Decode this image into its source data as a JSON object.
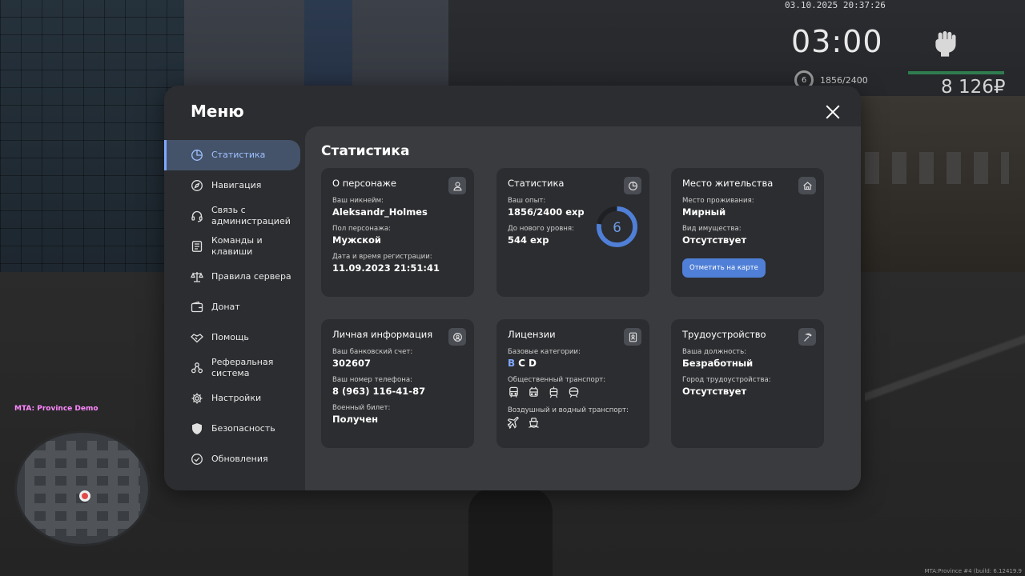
{
  "hud": {
    "datetime": "03.10.2025 20:37:26",
    "clock": "03:00",
    "level": "6",
    "exp": "1856/2400",
    "money": "8 126₽",
    "server": "MTA: Province Demo",
    "build": "MTA:Province #4 (build: 6.12419.9"
  },
  "menu": {
    "title": "Меню",
    "nav": [
      {
        "label": "Статистика",
        "icon": "pie-chart-icon"
      },
      {
        "label": "Навигация",
        "icon": "compass-icon"
      },
      {
        "label": "Связь с администрацией",
        "icon": "headset-icon"
      },
      {
        "label": "Команды и клавиши",
        "icon": "keyboard-icon"
      },
      {
        "label": "Правила сервера",
        "icon": "scales-icon"
      },
      {
        "label": "Донат",
        "icon": "wallet-icon"
      },
      {
        "label": "Помощь",
        "icon": "handshake-icon"
      },
      {
        "label": "Реферальная система",
        "icon": "network-icon"
      },
      {
        "label": "Настройки",
        "icon": "gear-icon"
      },
      {
        "label": "Безопасность",
        "icon": "shield-icon"
      },
      {
        "label": "Обновления",
        "icon": "check-circle-icon"
      }
    ]
  },
  "stats": {
    "title": "Статистика",
    "character": {
      "heading": "О персонаже",
      "nickname_label": "Ваш никнейм:",
      "nickname": "Aleksandr_Holmes",
      "gender_label": "Пол персонажа:",
      "gender": "Мужской",
      "reg_label": "Дата и время регистрации:",
      "reg": "11.09.2023 21:51:41"
    },
    "progress": {
      "heading": "Статистика",
      "exp_label": "Ваш опыт:",
      "exp": "1856/2400 exp",
      "next_label": "До нового уровня:",
      "next": "544 exp",
      "level": "6",
      "fraction": 0.7733
    },
    "residence": {
      "heading": "Место жительства",
      "place_label": "Место проживания:",
      "place": "Мирный",
      "property_label": "Вид имущества:",
      "property": "Отсутствует",
      "button": "Отметить на карте"
    },
    "personal": {
      "heading": "Личная информация",
      "bank_label": "Ваш банковский счет:",
      "bank": "302607",
      "phone_label": "Ваш номер телефона:",
      "phone": "8 (963) 116-41-87",
      "military_label": "Военный билет:",
      "military": "Получен"
    },
    "licenses": {
      "heading": "Лицензии",
      "base_label": "Базовые категории:",
      "cat_b": "B",
      "cat_c": "C",
      "cat_d": "D",
      "public_label": "Общественный транспорт:",
      "air_label": "Воздушный и водный транспорт:"
    },
    "job": {
      "heading": "Трудоустройство",
      "position_label": "Ваша должность:",
      "position": "Безработный",
      "city_label": "Город трудоустройства:",
      "city": "Отсутствует"
    }
  },
  "colors": {
    "accent": "#4f7fd6",
    "active_nav_bg": "#44536a",
    "active_nav_text": "#9fc1ff"
  }
}
